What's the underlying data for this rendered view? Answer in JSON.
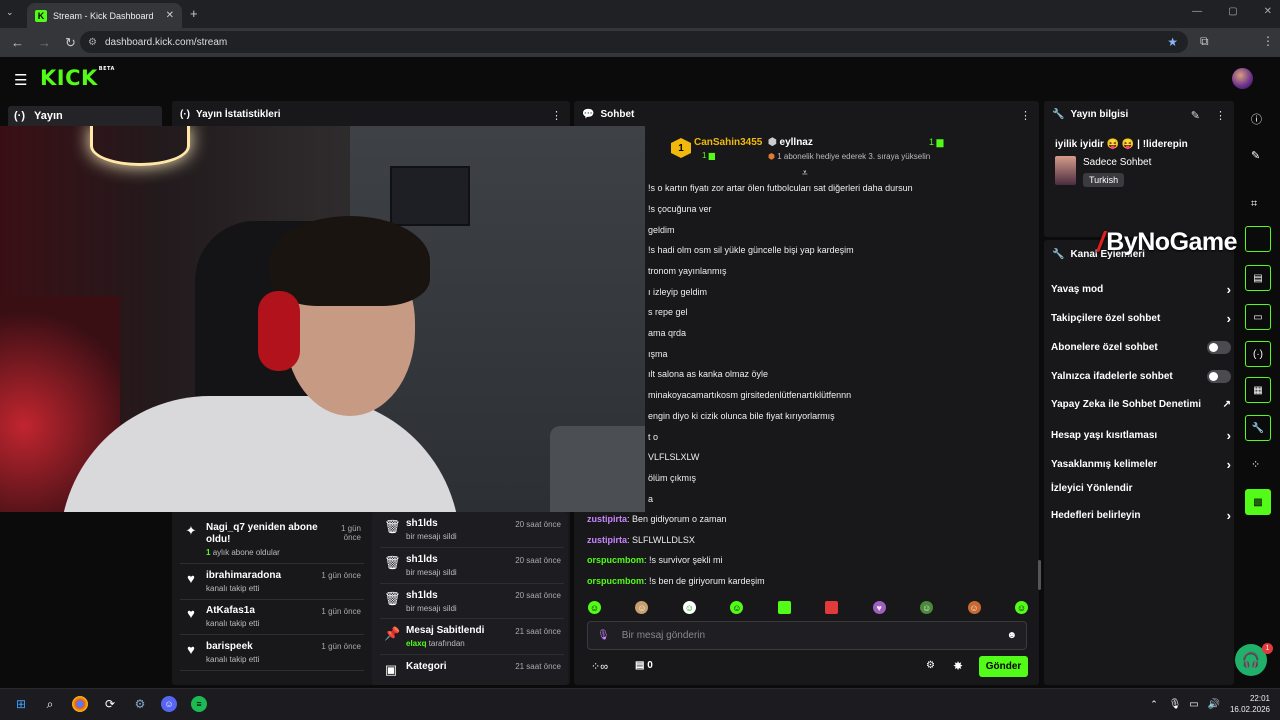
{
  "browser": {
    "tab_title": "Stream - Kick Dashboard",
    "tab_close": "✕",
    "new_tab": "+",
    "url": "dashboard.kick.com/stream",
    "window_controls": [
      "—",
      "▢",
      "✕"
    ]
  },
  "header": {
    "logo": "KICK",
    "logo_tag": "BETA"
  },
  "sidebar": {
    "section_label": "Yayın"
  },
  "stats": {
    "title": "Yayın İstatistikleri"
  },
  "activity_left": [
    {
      "title": "Nagi_q7 yeniden abone oldu!",
      "sub_count": "1",
      "sub_text": "aylık abone oldular",
      "time": "1 gün önce",
      "icon": "sparkle-icon"
    },
    {
      "title": "ibrahimaradona",
      "sub_text": "kanalı takip etti",
      "time": "1 gün önce",
      "icon": "heart-icon"
    },
    {
      "title": "AtKafas1a",
      "sub_text": "kanalı takip etti",
      "time": "1 gün önce",
      "icon": "heart-icon"
    },
    {
      "title": "barispeek",
      "sub_text": "kanalı takip etti",
      "time": "1 gün önce",
      "icon": "heart-icon"
    }
  ],
  "activity_right": [
    {
      "title": "sh1lds",
      "sub_text": "bir mesajı sildi",
      "time": "20 saat önce",
      "icon": "trash-icon"
    },
    {
      "title": "sh1lds",
      "sub_text": "bir mesajı sildi",
      "time": "20 saat önce",
      "icon": "trash-icon"
    },
    {
      "title": "sh1lds",
      "sub_text": "bir mesajı sildi",
      "time": "20 saat önce",
      "icon": "trash-icon"
    },
    {
      "title": "Mesaj Sabitlendi",
      "sub_user": "elaxq",
      "sub_text": "tarafından",
      "time": "21 saat önce",
      "icon": "pin-icon"
    },
    {
      "title": "Kategori",
      "time": "21 saat önce",
      "icon": "category-icon"
    }
  ],
  "chat": {
    "title": "Sohbet",
    "pinned_user": "CanSahin3455",
    "pinned_user_count": "1",
    "gifter_badge": "1",
    "gift_user": "eyllnaz",
    "gift_count": "1",
    "gift_text": "1 abonelik hediye ederek 3. sıraya yükselin",
    "partial_messages": [
      "!s o kartın fiyatı zor artar ölen futbolcuları sat diğerleri daha dursun",
      "!s çocuğuna ver",
      "geldim",
      "!s hadi olm osm sil yükle güncelle bişi yap kardeşim",
      "tronom yayınlanmış",
      "ı izleyip geldim",
      "s repe gel",
      "ama qrda",
      "ışma",
      "ılt salona as kanka olmaz öyle",
      "minakoyacamartıkosm girsitedenlütfenartıklütfennn",
      "engin diyo ki cizik olunca bile fiyat kırıyorlarmış",
      "t o",
      "VLFLSLXLW",
      "ölüm çıkmış",
      "a"
    ],
    "messages": [
      {
        "user": "zustipirta",
        "color": "#c986ff",
        "text": ": Ben gidiyorum o zaman"
      },
      {
        "user": "zustipirta",
        "color": "#c986ff",
        "text": ": SLFLWLLDLSX"
      },
      {
        "user": "orspucmbom",
        "color": "#53fc18",
        "text": ": !s survivor şekli mi"
      },
      {
        "user": "orspucmbom",
        "color": "#53fc18",
        "text": ": !s ben de giriyorum kardeşim"
      }
    ],
    "input_placeholder": "Bir mesaj gönderin",
    "points_symbol": "∞",
    "points_count": "0",
    "send_label": "Gönder"
  },
  "stream_info": {
    "title": "Yayın bilgisi",
    "stream_title": "iyilik iyidir 😝 😝 | !liderepin",
    "category": "Sadece Sohbet",
    "language": "Turkish"
  },
  "channel_actions": {
    "title": "Kanal Eylemleri",
    "items": [
      {
        "label": "Yavaş mod",
        "control": "chevron"
      },
      {
        "label": "Takipçilere özel sohbet",
        "control": "chevron"
      },
      {
        "label": "Abonelere özel sohbet",
        "control": "toggle"
      },
      {
        "label": "Yalnızca ifadelerle sohbet",
        "control": "toggle"
      },
      {
        "label": "Yapay Zeka ile Sohbet Denetimi",
        "control": "external"
      },
      {
        "label": "Hesap yaşı kısıtlaması",
        "control": "chevron"
      },
      {
        "label": "Yasaklanmış kelimeler",
        "control": "chevron"
      },
      {
        "label": "İzleyici Yönlendir",
        "control": "none"
      },
      {
        "label": "Hedefleri belirleyin",
        "control": "chevron"
      }
    ]
  },
  "watermark": "ByNoGame",
  "help_badge": "1",
  "taskbar": {
    "time": "22:01",
    "date": "16.02.2026"
  },
  "colors": {
    "brand": "#53fc18",
    "panel": "#18181b",
    "background": "#0b0b0c"
  }
}
